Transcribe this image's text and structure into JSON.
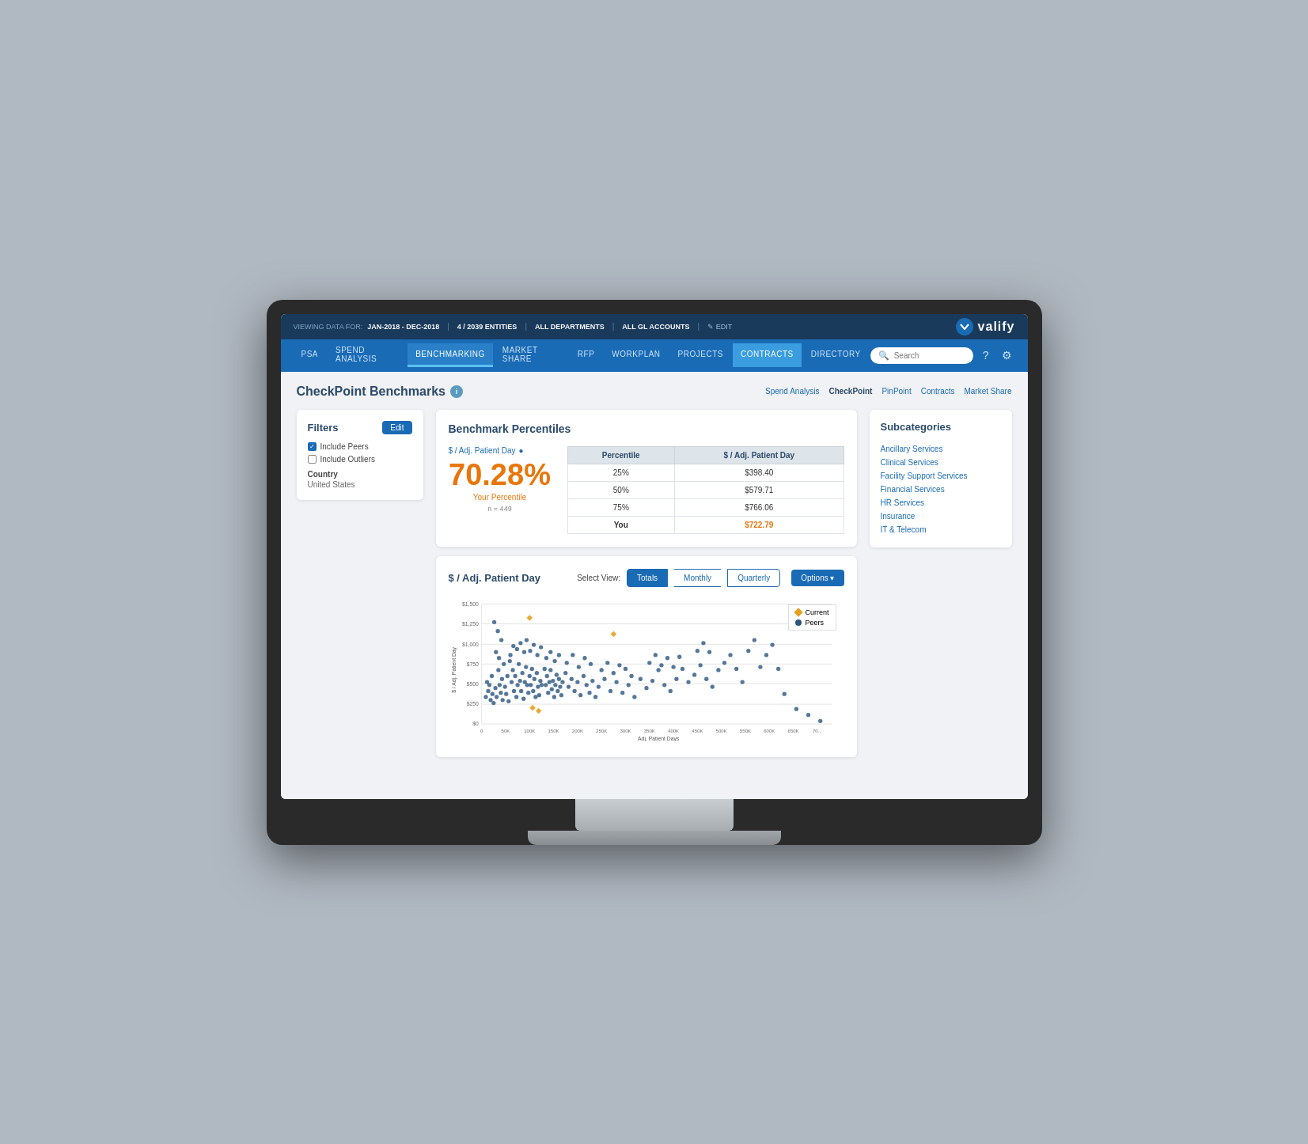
{
  "topbar": {
    "viewing_label": "VIEWING DATA FOR:",
    "date_range": "JAN-2018 - DEC-2018",
    "entities": "4 / 2039 ENTITIES",
    "departments": "ALL DEPARTMENTS",
    "gl_accounts": "ALL GL ACCOUNTS",
    "edit": "✎ EDIT"
  },
  "logo": {
    "text": "valify",
    "icon": "✓"
  },
  "nav": {
    "items": [
      {
        "label": "PSA",
        "active": false
      },
      {
        "label": "SPEND ANALYSIS",
        "active": false
      },
      {
        "label": "BENCHMARKING",
        "active": true
      },
      {
        "label": "MARKET SHARE",
        "active": false
      },
      {
        "label": "RFP",
        "active": false
      },
      {
        "label": "WORKPLAN",
        "active": false
      },
      {
        "label": "PROJECTS",
        "active": false
      },
      {
        "label": "CONTRACTS",
        "active": false,
        "highlighted": true
      },
      {
        "label": "DIRECTORY",
        "active": false
      }
    ],
    "search_placeholder": "Search"
  },
  "breadcrumb": {
    "page_title": "CheckPoint Benchmarks",
    "links": [
      {
        "label": "Spend Analysis",
        "active": false
      },
      {
        "label": "CheckPoint",
        "active": true
      },
      {
        "label": "PinPoint",
        "active": false
      },
      {
        "label": "Contracts",
        "active": false
      },
      {
        "label": "Market Share",
        "active": false
      }
    ]
  },
  "filters": {
    "title": "Filters",
    "edit_label": "Edit",
    "include_peers_label": "Include Peers",
    "include_peers_checked": true,
    "include_outliers_label": "Include Outliers",
    "include_outliers_checked": false,
    "country_label": "Country",
    "country_value": "United States"
  },
  "benchmark": {
    "title": "Benchmark Percentiles",
    "metric_label": "$ / Adj. Patient Day",
    "big_number": "70.28%",
    "your_percentile": "Your Percentile",
    "n_count": "n = 449",
    "table": {
      "headers": [
        "Percentile",
        "$ / Adj. Patient Day"
      ],
      "rows": [
        {
          "percentile": "25%",
          "value": "$398.40"
        },
        {
          "percentile": "50%",
          "value": "$579.71"
        },
        {
          "percentile": "75%",
          "value": "$766.06"
        },
        {
          "percentile": "You",
          "value": "$722.79",
          "highlight": true
        }
      ]
    }
  },
  "chart": {
    "title": "$ / Adj. Patient Day",
    "select_view_label": "Select View:",
    "view_buttons": [
      {
        "label": "Totals",
        "active": true
      },
      {
        "label": "Monthly",
        "active": false
      },
      {
        "label": "Quarterly",
        "active": false
      }
    ],
    "options_label": "Options ▾",
    "y_axis_title": "$ / Adj. Patient Day",
    "x_axis_title": "Adj. Patient Days",
    "y_axis_labels": [
      "$1,500",
      "$1,250",
      "$1,000",
      "$750",
      "$500",
      "$250",
      "$0"
    ],
    "x_axis_labels": [
      "0",
      "50K",
      "100K",
      "150K",
      "200K",
      "250K",
      "300K",
      "350K",
      "400K",
      "450K",
      "500K",
      "550K",
      "600K",
      "650K",
      "70..."
    ],
    "legend": {
      "current": "Current",
      "peers": "Peers"
    }
  },
  "subcategories": {
    "title": "Subcategories",
    "items": [
      "Ancillary Services",
      "Clinical Services",
      "Facility Support Services",
      "Financial Services",
      "HR Services",
      "Insurance",
      "IT & Telecom"
    ]
  }
}
